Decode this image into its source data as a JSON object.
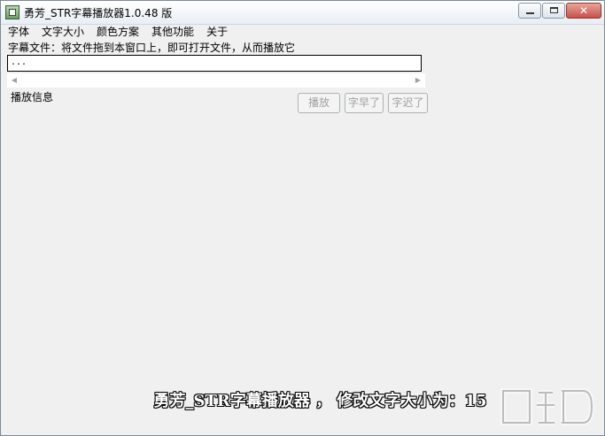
{
  "window": {
    "title": "勇芳_STR字幕播放器1.0.48 版"
  },
  "menu": {
    "items": [
      "字体",
      "文字大小",
      "颜色方案",
      "其他功能",
      "关于"
    ]
  },
  "hint": "字幕文件：将文件拖到本窗口上，即可打开文件，从而播放它",
  "file_input": {
    "value": "..."
  },
  "play_info_label": "播放信息",
  "buttons": {
    "play": "播放",
    "subtitle_early": "字早了",
    "subtitle_late": "字迟了"
  },
  "subtitle_text": "勇芳_STR字幕播放器 ， 修改文字大小为：15",
  "colors": {
    "window_bg": "#f0f0f0",
    "close_button": "#c75050"
  },
  "icons": {
    "app": "app-icon",
    "minimize": "minimize-icon",
    "maximize": "maximize-icon",
    "close": "close-icon",
    "scroll_left": "scroll-left-arrow-icon",
    "scroll_right": "scroll-right-arrow-icon"
  }
}
